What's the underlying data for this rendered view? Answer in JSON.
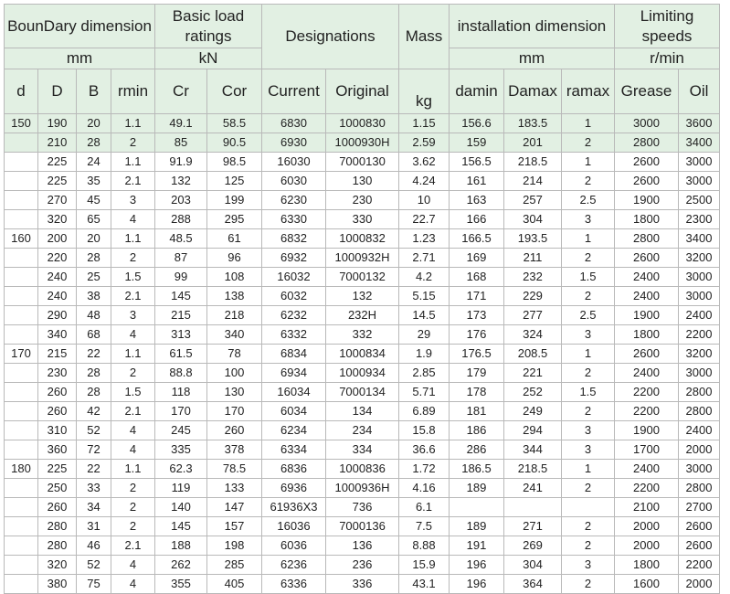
{
  "header": {
    "boundary_dimension": "BounDary dimension",
    "boundary_unit": "mm",
    "basic_load_ratings": "Basic load ratings",
    "load_unit": "kN",
    "designations": "Designations",
    "mass": "Mass",
    "mass_unit": "kg",
    "installation_dimension": "installation dimension",
    "installation_unit": "mm",
    "limiting_speeds": "Limiting speeds",
    "speed_unit": "r/min",
    "columns": [
      "d",
      "D",
      "B",
      "rmin",
      "Cr",
      "Cor",
      "Current",
      "Original",
      "damin",
      "Damax",
      "ramax",
      "Grease",
      "Oil"
    ]
  },
  "rows": [
    [
      "150",
      "190",
      "20",
      "1.1",
      "49.1",
      "58.5",
      "6830",
      "1000830",
      "1.15",
      "156.6",
      "183.5",
      "1",
      "3000",
      "3600"
    ],
    [
      "",
      "210",
      "28",
      "2",
      "85",
      "90.5",
      "6930",
      "1000930H",
      "2.59",
      "159",
      "201",
      "2",
      "2800",
      "3400"
    ],
    [
      "",
      "225",
      "24",
      "1.1",
      "91.9",
      "98.5",
      "16030",
      "7000130",
      "3.62",
      "156.5",
      "218.5",
      "1",
      "2600",
      "3000"
    ],
    [
      "",
      "225",
      "35",
      "2.1",
      "132",
      "125",
      "6030",
      "130",
      "4.24",
      "161",
      "214",
      "2",
      "2600",
      "3000"
    ],
    [
      "",
      "270",
      "45",
      "3",
      "203",
      "199",
      "6230",
      "230",
      "10",
      "163",
      "257",
      "2.5",
      "1900",
      "2500"
    ],
    [
      "",
      "320",
      "65",
      "4",
      "288",
      "295",
      "6330",
      "330",
      "22.7",
      "166",
      "304",
      "3",
      "1800",
      "2300"
    ],
    [
      "160",
      "200",
      "20",
      "1.1",
      "48.5",
      "61",
      "6832",
      "1000832",
      "1.23",
      "166.5",
      "193.5",
      "1",
      "2800",
      "3400"
    ],
    [
      "",
      "220",
      "28",
      "2",
      "87",
      "96",
      "6932",
      "1000932H",
      "2.71",
      "169",
      "211",
      "2",
      "2600",
      "3200"
    ],
    [
      "",
      "240",
      "25",
      "1.5",
      "99",
      "108",
      "16032",
      "7000132",
      "4.2",
      "168",
      "232",
      "1.5",
      "2400",
      "3000"
    ],
    [
      "",
      "240",
      "38",
      "2.1",
      "145",
      "138",
      "6032",
      "132",
      "5.15",
      "171",
      "229",
      "2",
      "2400",
      "3000"
    ],
    [
      "",
      "290",
      "48",
      "3",
      "215",
      "218",
      "6232",
      "232H",
      "14.5",
      "173",
      "277",
      "2.5",
      "1900",
      "2400"
    ],
    [
      "",
      "340",
      "68",
      "4",
      "313",
      "340",
      "6332",
      "332",
      "29",
      "176",
      "324",
      "3",
      "1800",
      "2200"
    ],
    [
      "170",
      "215",
      "22",
      "1.1",
      "61.5",
      "78",
      "6834",
      "1000834",
      "1.9",
      "176.5",
      "208.5",
      "1",
      "2600",
      "3200"
    ],
    [
      "",
      "230",
      "28",
      "2",
      "88.8",
      "100",
      "6934",
      "1000934",
      "2.85",
      "179",
      "221",
      "2",
      "2400",
      "3000"
    ],
    [
      "",
      "260",
      "28",
      "1.5",
      "118",
      "130",
      "16034",
      "7000134",
      "5.71",
      "178",
      "252",
      "1.5",
      "2200",
      "2800"
    ],
    [
      "",
      "260",
      "42",
      "2.1",
      "170",
      "170",
      "6034",
      "134",
      "6.89",
      "181",
      "249",
      "2",
      "2200",
      "2800"
    ],
    [
      "",
      "310",
      "52",
      "4",
      "245",
      "260",
      "6234",
      "234",
      "15.8",
      "186",
      "294",
      "3",
      "1900",
      "2400"
    ],
    [
      "",
      "360",
      "72",
      "4",
      "335",
      "378",
      "6334",
      "334",
      "36.6",
      "286",
      "344",
      "3",
      "1700",
      "2000"
    ],
    [
      "180",
      "225",
      "22",
      "1.1",
      "62.3",
      "78.5",
      "6836",
      "1000836",
      "1.72",
      "186.5",
      "218.5",
      "1",
      "2400",
      "3000"
    ],
    [
      "",
      "250",
      "33",
      "2",
      "119",
      "133",
      "6936",
      "1000936H",
      "4.16",
      "189",
      "241",
      "2",
      "2200",
      "2800"
    ],
    [
      "",
      "260",
      "34",
      "2",
      "140",
      "147",
      "61936X3",
      "736",
      "6.1",
      "",
      "",
      "",
      "2100",
      "2700"
    ],
    [
      "",
      "280",
      "31",
      "2",
      "145",
      "157",
      "16036",
      "7000136",
      "7.5",
      "189",
      "271",
      "2",
      "2000",
      "2600"
    ],
    [
      "",
      "280",
      "46",
      "2.1",
      "188",
      "198",
      "6036",
      "136",
      "8.88",
      "191",
      "269",
      "2",
      "2000",
      "2600"
    ],
    [
      "",
      "320",
      "52",
      "4",
      "262",
      "285",
      "6236",
      "236",
      "15.9",
      "196",
      "304",
      "3",
      "1800",
      "2200"
    ],
    [
      "",
      "380",
      "75",
      "4",
      "355",
      "405",
      "6336",
      "336",
      "43.1",
      "196",
      "364",
      "2",
      "1600",
      "2000"
    ]
  ],
  "highlighted_rows": [
    0,
    1
  ]
}
